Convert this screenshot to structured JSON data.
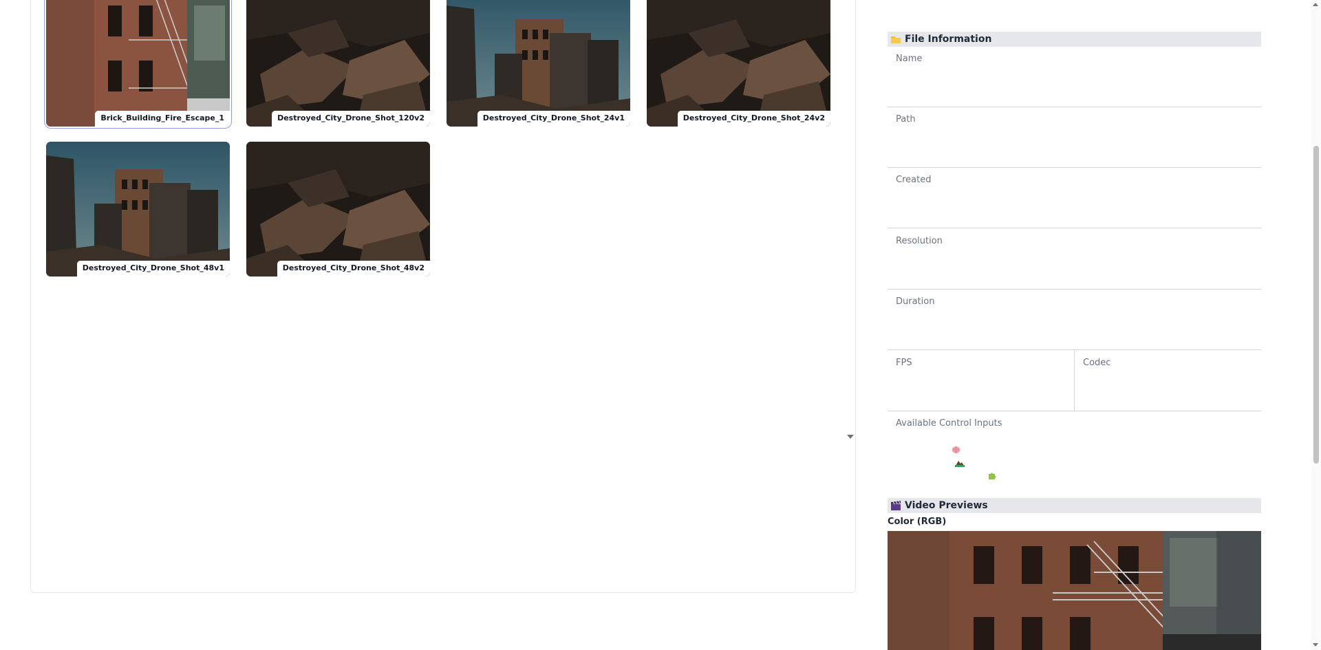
{
  "gallery": {
    "items": [
      {
        "label": "Brick_Building_Fire_Escape_1",
        "scene": "brick",
        "selected": true
      },
      {
        "label": "Destroyed_City_Drone_Shot_120v2",
        "scene": "rubble",
        "selected": false
      },
      {
        "label": "Destroyed_City_Drone_Shot_24v1",
        "scene": "city",
        "selected": false
      },
      {
        "label": "Destroyed_City_Drone_Shot_24v2",
        "scene": "rubble",
        "selected": false
      },
      {
        "label": "Destroyed_City_Drone_Shot_48v1",
        "scene": "city",
        "selected": false
      },
      {
        "label": "Destroyed_City_Drone_Shot_48v2",
        "scene": "rubble",
        "selected": false
      }
    ]
  },
  "file_info": {
    "title": "File Information",
    "icon": "folder-icon",
    "fields": {
      "name": {
        "label": "Name",
        "value": ""
      },
      "path": {
        "label": "Path",
        "value": ""
      },
      "created": {
        "label": "Created",
        "value": ""
      },
      "resolution": {
        "label": "Resolution",
        "value": ""
      },
      "duration": {
        "label": "Duration",
        "value": ""
      },
      "fps": {
        "label": "FPS",
        "value": ""
      },
      "codec": {
        "label": "Codec",
        "value": ""
      }
    },
    "control_inputs": {
      "label": "Available Control Inputs",
      "icons": [
        "brain-icon",
        "mountain-icon",
        "puzzle-icon"
      ]
    }
  },
  "video_previews": {
    "title": "Video Previews",
    "icon": "clapperboard-icon",
    "color_label": "Color (RGB)"
  },
  "colors": {
    "selected_outline": "#8ea0d8",
    "section_header_bg": "#e5e7eb"
  }
}
